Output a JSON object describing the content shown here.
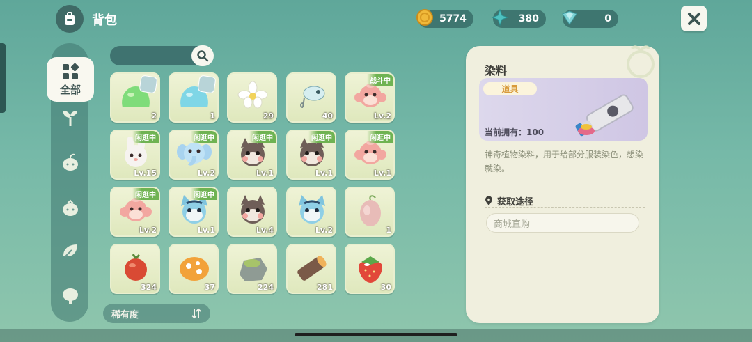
{
  "header": {
    "title": "背包",
    "bag_icon": "backpack-icon",
    "close_icon": "close-icon"
  },
  "currencies": [
    {
      "name": "gold-coin",
      "value": "5774",
      "icon": "coin-icon"
    },
    {
      "name": "blue-star-shard",
      "value": "380",
      "icon": "star-shard-icon"
    },
    {
      "name": "crystal-fan",
      "value": "0",
      "icon": "crystal-icon"
    }
  ],
  "categories": {
    "all_label": "全部",
    "items": [
      "sprout-icon",
      "leaf-bud-icon",
      "seedling-icon",
      "vine-leaf-icon",
      "tree-icon"
    ]
  },
  "search": {
    "icon": "search-icon"
  },
  "grid": [
    {
      "name": "green-slime",
      "count": "2",
      "badge": "",
      "tag": true
    },
    {
      "name": "blue-slime",
      "count": "1",
      "badge": "",
      "tag": true
    },
    {
      "name": "white-flower",
      "count": "29",
      "badge": "",
      "tag": false
    },
    {
      "name": "fishing-lure",
      "count": "40",
      "badge": "",
      "tag": false
    },
    {
      "name": "monkey-pet",
      "count": "Lv.2",
      "badge": "战斗中",
      "tag": false
    },
    {
      "name": "bunny-pet",
      "count": "Lv.15",
      "badge": "闲逛中",
      "tag": false
    },
    {
      "name": "elephant-pet",
      "count": "Lv.2",
      "badge": "闲逛中",
      "tag": false
    },
    {
      "name": "raccoon-pet",
      "count": "Lv.1",
      "badge": "闲逛中",
      "tag": false
    },
    {
      "name": "raccoon-pet",
      "count": "Lv.1",
      "badge": "闲逛中",
      "tag": false
    },
    {
      "name": "monkey-pet",
      "count": "Lv.1",
      "badge": "闲逛中",
      "tag": false
    },
    {
      "name": "monkey-pet",
      "count": "Lv.2",
      "badge": "闲逛中",
      "tag": false
    },
    {
      "name": "blue-cat-pet",
      "count": "Lv.1",
      "badge": "闲逛中",
      "tag": false
    },
    {
      "name": "raccoon-pet",
      "count": "Lv.4",
      "badge": "",
      "tag": false
    },
    {
      "name": "blue-cat-pet",
      "count": "Lv.2",
      "badge": "",
      "tag": false
    },
    {
      "name": "egg-seed",
      "count": "1",
      "badge": "",
      "tag": false
    },
    {
      "name": "red-berry",
      "count": "324",
      "badge": "",
      "tag": false
    },
    {
      "name": "orange-mushroom",
      "count": "37",
      "badge": "",
      "tag": false
    },
    {
      "name": "mossy-stone",
      "count": "224",
      "badge": "",
      "tag": false
    },
    {
      "name": "wood-log",
      "count": "281",
      "badge": "",
      "tag": false
    },
    {
      "name": "strawberry",
      "count": "30",
      "badge": "",
      "tag": false
    }
  ],
  "sort": {
    "label": "稀有度",
    "icon": "sort-icon"
  },
  "detail": {
    "title": "染料",
    "type": "道具",
    "owned": "当前拥有：100",
    "description": "神奇植物染料，用于给部分服装染色，想染就染。",
    "source_heading": "获取途径",
    "source_option": "商城直购",
    "pin_icon": "location-pin-icon",
    "image_icon": "dye-tube-icon"
  },
  "colors": {
    "accent_green": "#6fb352",
    "panel_bg": "#f0efde",
    "chip_text": "#d89a3a"
  }
}
